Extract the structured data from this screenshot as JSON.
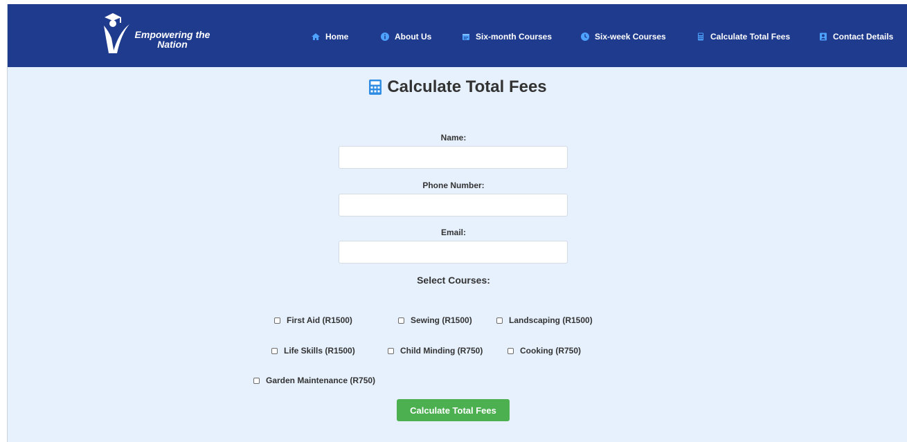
{
  "brand": {
    "name": "Empowering the Nation"
  },
  "nav": {
    "items": [
      {
        "label": "Home",
        "icon": "home-icon"
      },
      {
        "label": "About Us",
        "icon": "info-icon"
      },
      {
        "label": "Six-month Courses",
        "icon": "calendar-icon"
      },
      {
        "label": "Six-week Courses",
        "icon": "clock-icon"
      },
      {
        "label": "Calculate Total Fees",
        "icon": "calculator-icon"
      },
      {
        "label": "Contact Details",
        "icon": "contact-card-icon"
      }
    ]
  },
  "page": {
    "title": "Calculate Total Fees",
    "title_icon": "calculator-icon"
  },
  "form": {
    "name_label": "Name:",
    "name_value": "",
    "phone_label": "Phone Number:",
    "phone_value": "",
    "email_label": "Email:",
    "email_value": "",
    "courses_heading": "Select Courses:",
    "courses": [
      {
        "label": "First Aid (R1500)",
        "checked": false
      },
      {
        "label": "Sewing (R1500)",
        "checked": false
      },
      {
        "label": "Landscaping (R1500)",
        "checked": false
      },
      {
        "label": "Life Skills (R1500)",
        "checked": false
      },
      {
        "label": "Child Minding (R750)",
        "checked": false
      },
      {
        "label": "Cooking (R750)",
        "checked": false
      },
      {
        "label": "Garden Maintenance (R750)",
        "checked": false
      }
    ],
    "submit_label": "Calculate Total Fees"
  },
  "colors": {
    "navbar": "#1f3b8e",
    "page_background": "#e6f1fd",
    "nav_icon": "#4da3ff",
    "submit_button": "#4caf50"
  }
}
